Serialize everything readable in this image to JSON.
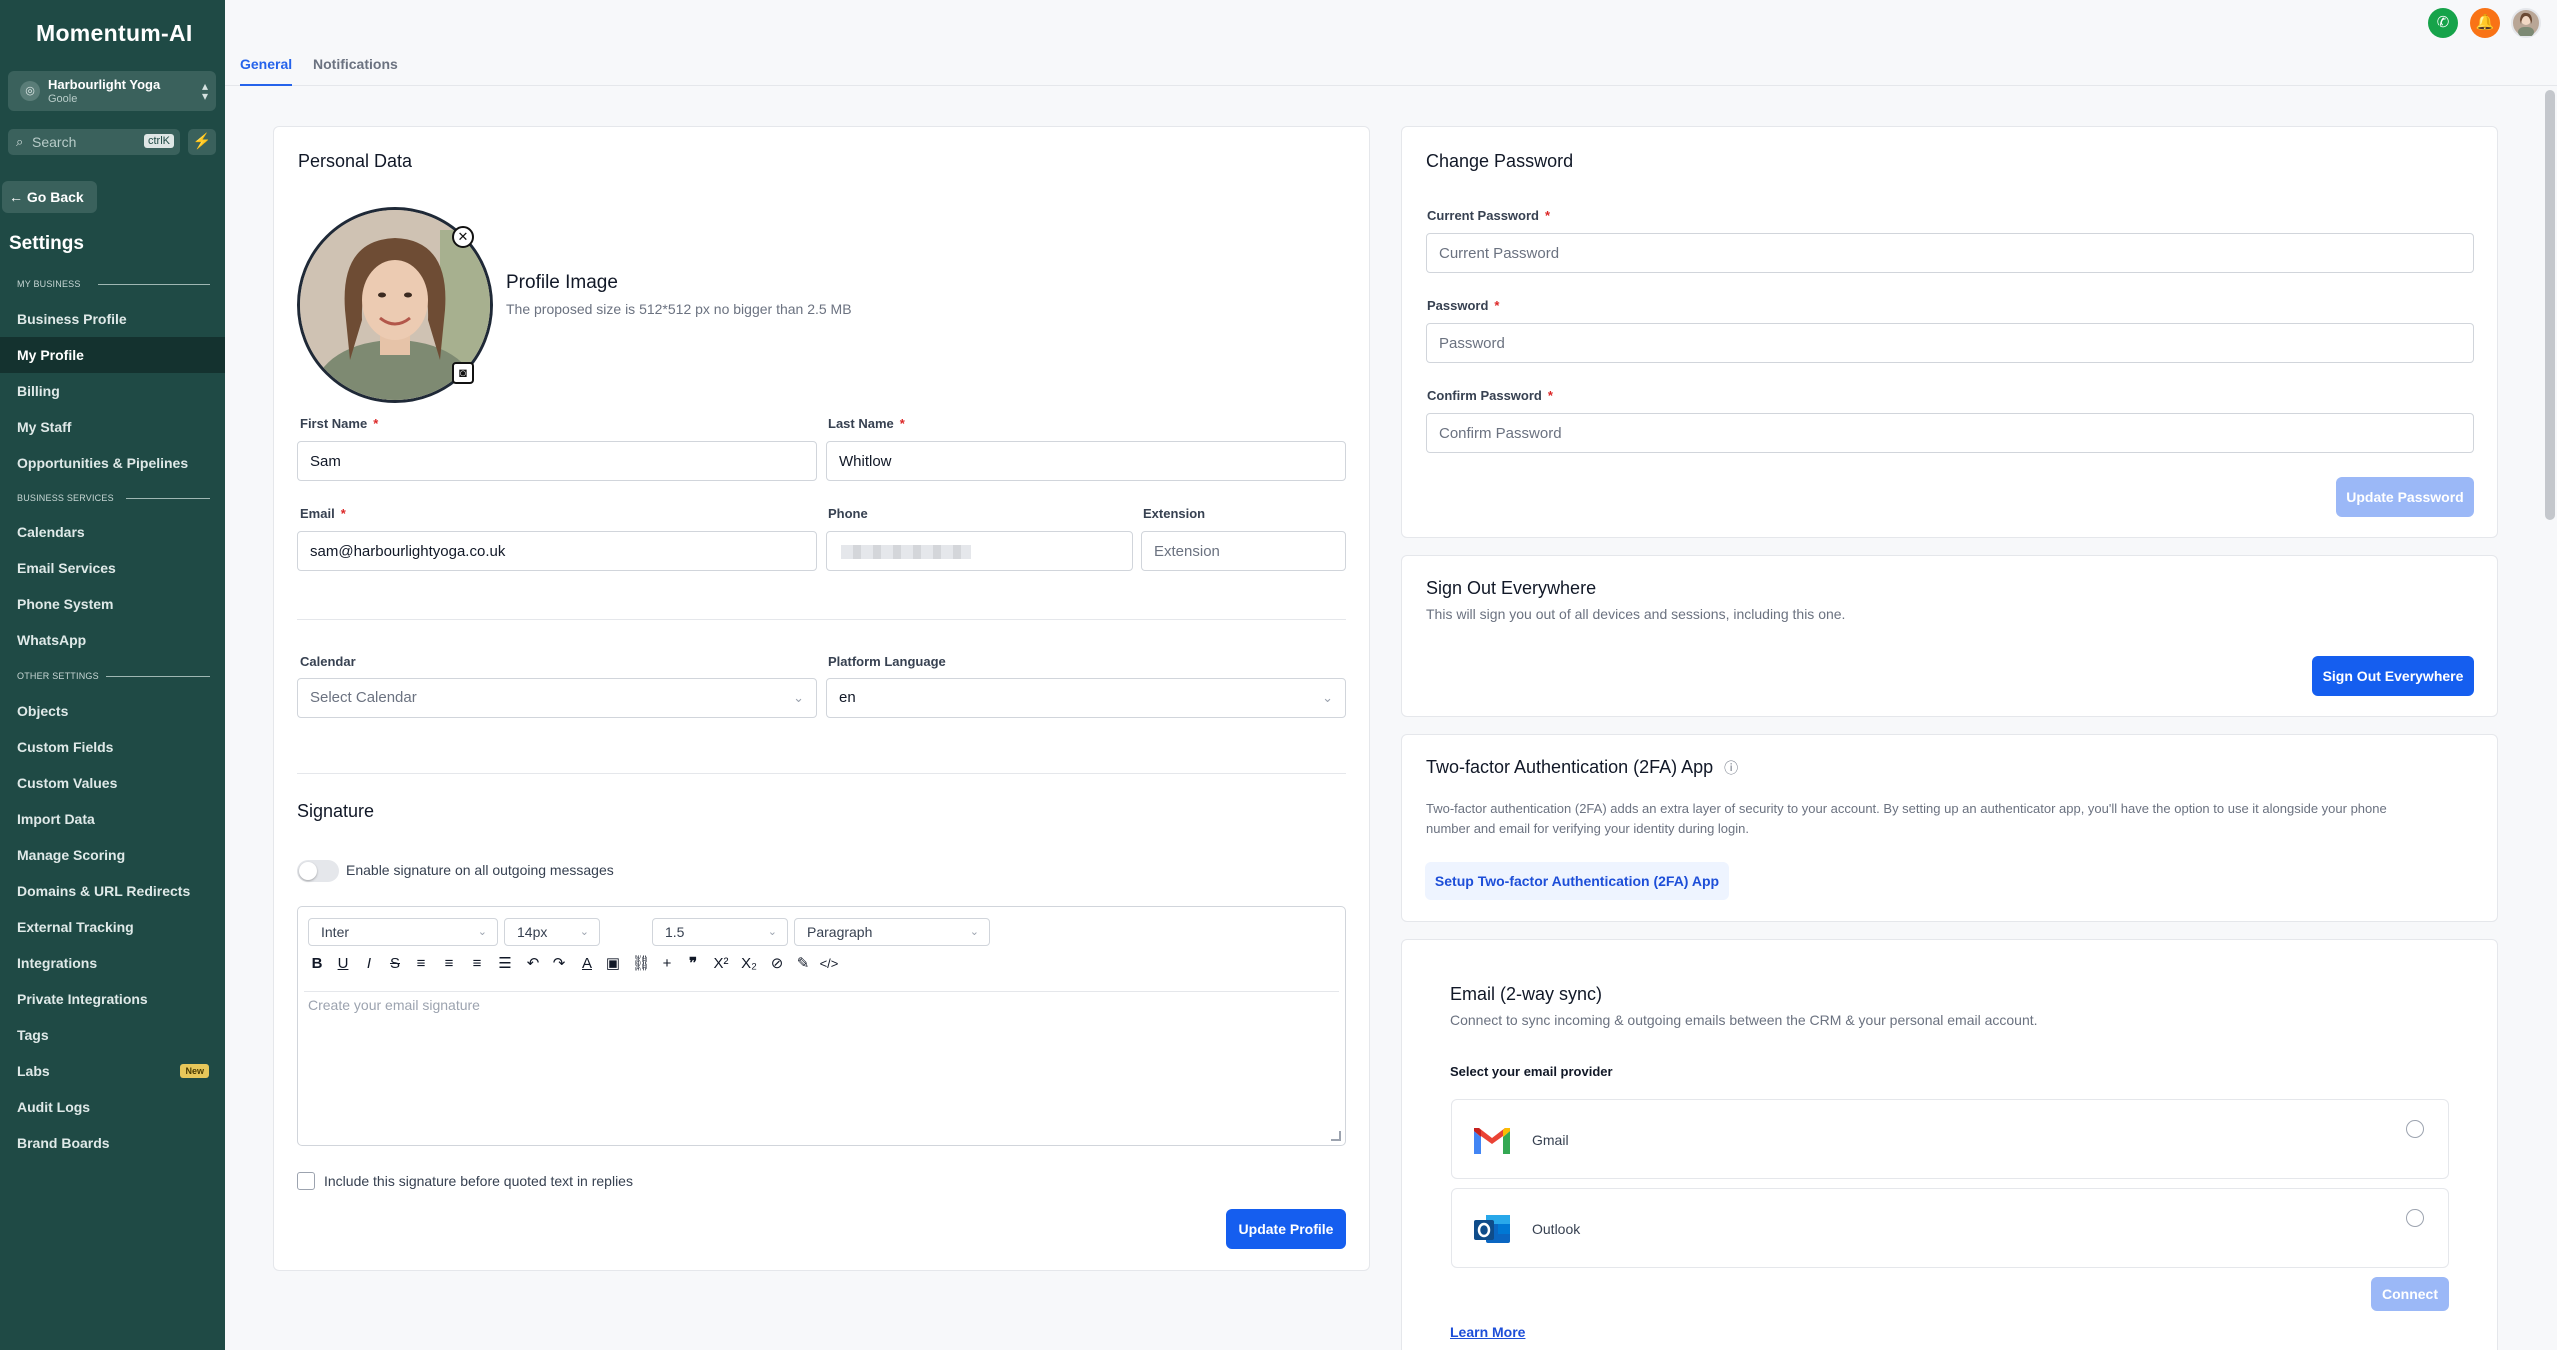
{
  "app": {
    "logo": "Momentum-AI"
  },
  "account": {
    "name": "Harbourlight Yoga",
    "sub": "Goole",
    "initial": "◎"
  },
  "search": {
    "placeholder": "Search",
    "shortcut": "ctrlK"
  },
  "sidebar": {
    "go_back": "← Go Back",
    "title": "Settings",
    "sections": {
      "my_business": "MY BUSINESS",
      "business_services": "BUSINESS SERVICES",
      "other_settings": "OTHER SETTINGS"
    },
    "items": [
      {
        "label": "Business Profile"
      },
      {
        "label": "My Profile"
      },
      {
        "label": "Billing"
      },
      {
        "label": "My Staff"
      },
      {
        "label": "Opportunities & Pipelines"
      },
      {
        "label": "Calendars"
      },
      {
        "label": "Email Services"
      },
      {
        "label": "Phone System"
      },
      {
        "label": "WhatsApp"
      },
      {
        "label": "Objects"
      },
      {
        "label": "Custom Fields"
      },
      {
        "label": "Custom Values"
      },
      {
        "label": "Import Data"
      },
      {
        "label": "Manage Scoring"
      },
      {
        "label": "Domains & URL Redirects"
      },
      {
        "label": "External Tracking"
      },
      {
        "label": "Integrations"
      },
      {
        "label": "Private Integrations"
      },
      {
        "label": "Tags"
      },
      {
        "label": "Labs"
      },
      {
        "label": "Audit Logs"
      },
      {
        "label": "Brand Boards"
      }
    ],
    "labs_badge": "New"
  },
  "tabs": [
    {
      "label": "General"
    },
    {
      "label": "Notifications"
    }
  ],
  "personal": {
    "title": "Personal Data",
    "profile_image_title": "Profile Image",
    "profile_image_hint": "The proposed size is 512*512 px no bigger than 2.5 MB",
    "first_name_label": "First Name",
    "first_name_value": "Sam",
    "last_name_label": "Last Name",
    "last_name_value": "Whitlow",
    "email_label": "Email",
    "email_value": "sam@harbourlightyoga.co.uk",
    "phone_label": "Phone",
    "extension_label": "Extension",
    "extension_placeholder": "Extension",
    "required_mark": "*",
    "calendar_label": "Calendar",
    "calendar_value": "Select Calendar",
    "language_label": "Platform Language",
    "language_value": "en"
  },
  "signature": {
    "title": "Signature",
    "toggle_label": "Enable signature on all outgoing messages",
    "font": "Inter",
    "size": "14px",
    "line_height": "1.5",
    "block": "Paragraph",
    "placeholder": "Create your email signature",
    "include_label": "Include this signature before quoted text in replies",
    "update_button": "Update Profile"
  },
  "password": {
    "title": "Change Password",
    "current_label": "Current Password",
    "current_placeholder": "Current Password",
    "password_label": "Password",
    "password_placeholder": "Password",
    "confirm_label": "Confirm Password",
    "confirm_placeholder": "Confirm Password",
    "update_button": "Update Password"
  },
  "signout": {
    "title": "Sign Out Everywhere",
    "desc": "This will sign you out of all devices and sessions, including this one.",
    "button": "Sign Out Everywhere"
  },
  "twofa": {
    "title": "Two-factor Authentication (2FA) App",
    "desc_line1": "Two-factor authentication (2FA) adds an extra layer of security to your account. By setting up an authenticator app, you'll have the option to use it alongside your phone",
    "desc_line2": "number and email for verifying your identity during login.",
    "button": "Setup Two-factor Authentication (2FA) App"
  },
  "email_sync": {
    "title": "Email (2-way sync)",
    "desc": "Connect to sync incoming & outgoing emails between the CRM & your personal email account.",
    "provider_label": "Select your email provider",
    "providers": [
      {
        "name": "Gmail"
      },
      {
        "name": "Outlook"
      }
    ],
    "connect_button": "Connect",
    "learn_more": "Learn More"
  },
  "colors": {
    "sidebar_bg": "#1f4a45",
    "primary": "#155eef",
    "phone_icon": "#16a34a",
    "bell_icon": "#f97316"
  }
}
